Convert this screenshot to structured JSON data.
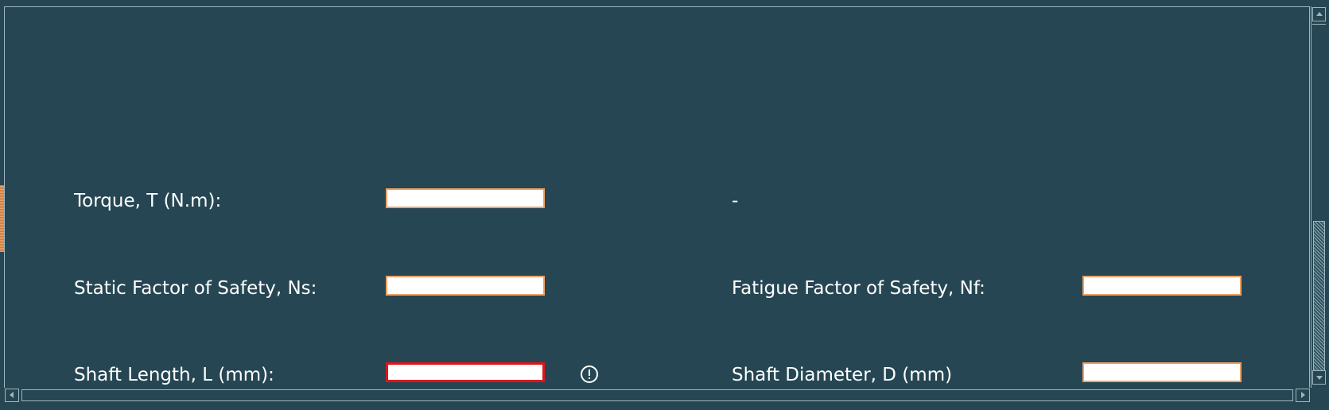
{
  "form": {
    "torque_label": "Torque, T (N.m):",
    "torque_value": "",
    "torque_result": "-",
    "static_fos_label": "Static Factor of Safety, Ns:",
    "static_fos_value": "",
    "fatigue_fos_label": "Fatigue Factor of Safety, Nf:",
    "fatigue_fos_value": "",
    "shaft_length_label": "Shaft Length, L (mm):",
    "shaft_length_value": "",
    "shaft_diameter_label": "Shaft Diameter, D (mm)",
    "shaft_diameter_value": ""
  },
  "icons": {
    "validation_error": "alert-circle-icon",
    "scroll_up": "triangle-up-icon",
    "scroll_down": "triangle-down-icon",
    "scroll_left": "triangle-left-icon",
    "scroll_right": "triangle-right-icon"
  },
  "colors": {
    "background": "#264653",
    "field_border": "#f0a164",
    "error_border": "#e0151b",
    "text": "#ffffff"
  }
}
